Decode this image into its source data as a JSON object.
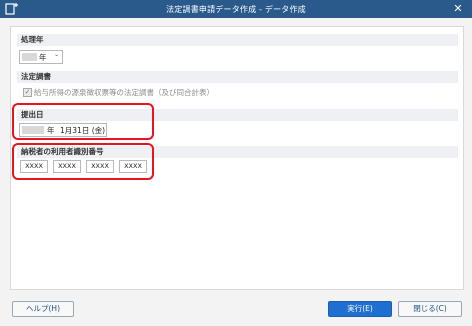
{
  "window": {
    "title": "法定調書申請データ作成 - データ作成",
    "close_symbol": "✕"
  },
  "sections": {
    "processing_year": {
      "header": "処理年",
      "year_suffix": "年",
      "dropdown_arrow": "⌄"
    },
    "legal_document": {
      "header": "法定調書",
      "checkbox_checked": true,
      "checkbox_mark": "✓",
      "checkbox_label": "給与所得の源泉徴収票等の法定調書（及び同合計表）"
    },
    "submission_date": {
      "header": "提出日",
      "year_suffix": "年",
      "date_text": "1月31日 (金)"
    },
    "taxpayer_id": {
      "header": "納税者の利用者識別番号",
      "fields": [
        "XXXX",
        "XXXX",
        "XXXX",
        "XXXX"
      ]
    }
  },
  "buttons": {
    "help": "ヘルプ(H)",
    "execute": "実行(E)",
    "close": "閉じる(C)"
  },
  "colors": {
    "titlebar": "#2a5a8c",
    "highlight": "#e8141e",
    "primary_button": "#1f6fd1"
  }
}
